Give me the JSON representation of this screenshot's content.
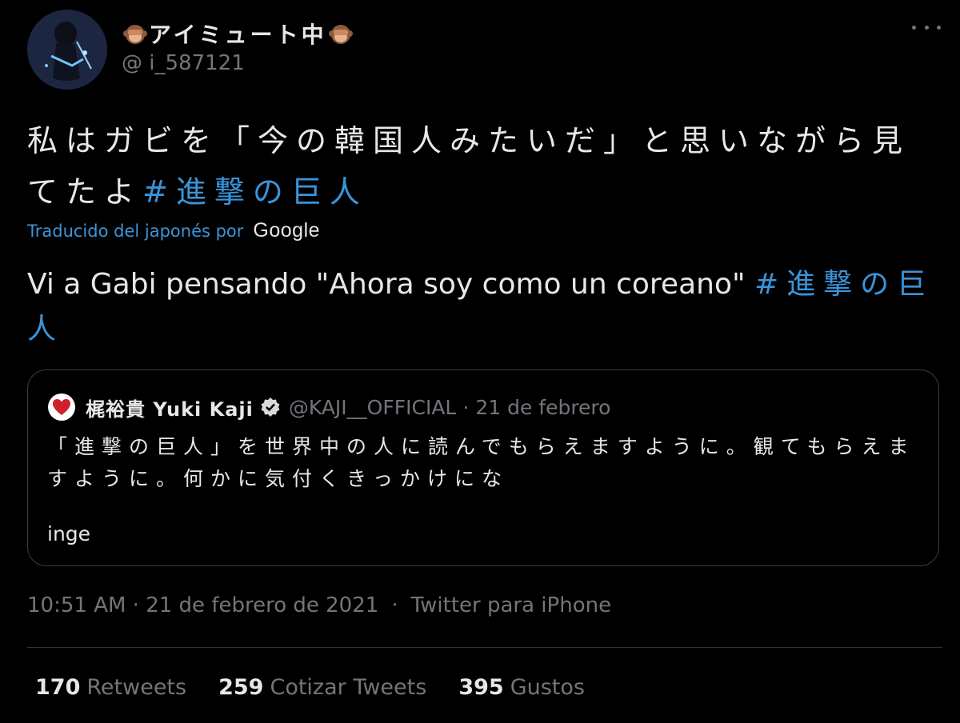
{
  "author": {
    "display_name": "アイミュート中",
    "handle": "@ i_587121",
    "avatar_icon": "user-avatar",
    "name_emoji_icon": "see-no-evil-monkey-icon"
  },
  "tweet": {
    "text_main": "私はガビを「今の韓国人みたいだ」と思いながら見てたよ",
    "hashtag": "#進撃の巨人",
    "translated_by_label": "Traducido del japonés por",
    "translator_brand": "Google",
    "translation_main": "Vi a Gabi pensando \"Ahora soy como un coreano\" ",
    "translation_hashtag": "#進撃の巨人"
  },
  "quoted": {
    "name": "梶裕貴 Yuki Kaji",
    "handle": "@KAJI__OFFICIAL",
    "separator": "·",
    "date": "21 de febrero",
    "text": "「進撃の巨人」を世界中の人に読んでもらえますように。観てもらえますように。何かに気付くきっかけにな",
    "footer": "inge"
  },
  "meta": {
    "time": "10:51 AM · 21 de febrero de 2021",
    "separator": "·",
    "source": "Twitter para iPhone"
  },
  "stats": {
    "retweets_count": "170",
    "retweets_label": "Retweets",
    "quotes_count": "259",
    "quotes_label": "Cotizar Tweets",
    "likes_count": "395",
    "likes_label": "Gustos"
  },
  "colors": {
    "background": "#000000",
    "link": "#3b94d9",
    "muted": "#71767b",
    "text": "#e7e7e7",
    "border": "#3a3d42"
  }
}
